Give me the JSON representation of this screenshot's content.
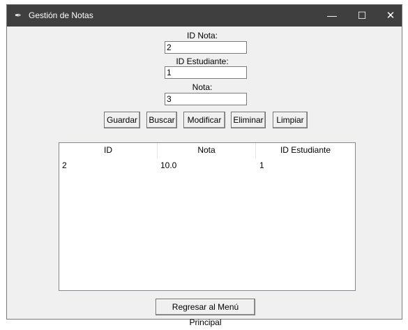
{
  "window": {
    "title": "Gestión de Notas",
    "icon": "feather-icon",
    "controls": {
      "minimize": "—",
      "maximize": "☐",
      "close": "✕"
    }
  },
  "form": {
    "id_nota_label": "ID Nota:",
    "id_nota_value": "2",
    "id_estudiante_label": "ID Estudiante:",
    "id_estudiante_value": "1",
    "nota_label": "Nota:",
    "nota_value": "3"
  },
  "buttons": {
    "guardar": "Guardar",
    "buscar": "Buscar",
    "modificar": "Modificar",
    "eliminar": "Eliminar",
    "limpiar": "Limpiar"
  },
  "table": {
    "columns": [
      "ID",
      "Nota",
      "ID Estudiante"
    ],
    "rows": [
      [
        "2",
        "10.0",
        "1"
      ]
    ]
  },
  "footer": {
    "back_button": "Regresar al Menú Principal"
  }
}
